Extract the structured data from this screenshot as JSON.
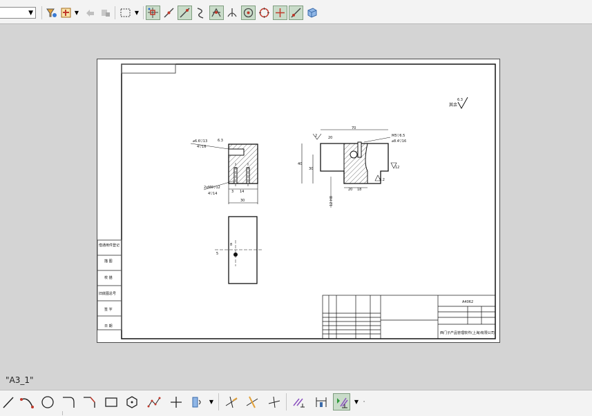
{
  "toolbar_top": {
    "combo_value": "",
    "icons": [
      "select-filter-icon",
      "snap-point-icon",
      "undo-icon",
      "redo-icon",
      "rectangle-select-icon",
      "snap-endpoint-icon",
      "snap-midpoint-icon",
      "snap-line-icon",
      "snap-curve-icon",
      "snap-intersection-icon",
      "snap-perpendicular-icon",
      "snap-center-icon",
      "snap-quadrant-icon",
      "snap-cross-icon",
      "snap-tangent-icon",
      "view-3d-icon"
    ]
  },
  "drawing": {
    "roughness_note": "其余",
    "roughness_value": "6.3",
    "dims": {
      "top_d1": "2",
      "top_d2": "20",
      "top_d3": "70",
      "top_hole": "M5▽6.5",
      "top_hole2": "⌀8.4▽16",
      "left_hole": "⌀6.6▽13",
      "left_hole2": "4▽16",
      "left_bottom_hole": "2xM6▽12",
      "left_bottom_hole2": "4▽14",
      "left_w1": "3",
      "left_w2": "14",
      "left_w3": "30",
      "left_top": "6.3",
      "h40": "40",
      "h30": "30",
      "b20": "20",
      "b18": "18",
      "r32": "3.2",
      "r12": "12",
      "h12": "12 H8",
      "plan_d": "5",
      "plan_c": "8"
    },
    "side_table": [
      "借通用件登记",
      "描 图",
      "校 描",
      "旧底图总号",
      "签 字",
      "日 期"
    ],
    "title_block": {
      "code": "A4062",
      "company": "西门子产品管理软件(上海)有限公司"
    }
  },
  "sheet_label": "\"A3_1\"",
  "toolbar_bottom": {
    "icons": [
      "line-icon",
      "arc-icon",
      "circle-icon",
      "fillet-icon",
      "chamfer-icon",
      "rectangle-icon",
      "polygon-icon",
      "spline-icon",
      "point-icon",
      "offset-icon",
      "trim-icon",
      "extend-icon",
      "divide-icon",
      "parallel-icon",
      "dimension-icon",
      "constraint-icon"
    ]
  }
}
